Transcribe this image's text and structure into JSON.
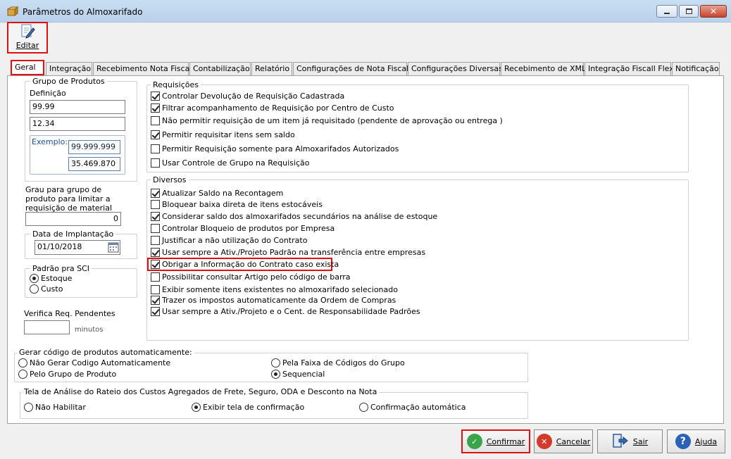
{
  "window": {
    "title": "Parâmetros do Almoxarifado",
    "controls": [
      "minimize-icon",
      "maximize-icon",
      "close-icon"
    ]
  },
  "toolbar": {
    "edit_label": "Editar"
  },
  "tabs": [
    {
      "label": "Geral",
      "active": true
    },
    {
      "label": "Integração"
    },
    {
      "label": "Recebimento Nota Fiscal"
    },
    {
      "label": "Contabilização"
    },
    {
      "label": "Relatório"
    },
    {
      "label": "Configurações de Nota Fiscal"
    },
    {
      "label": "Configurações Diversas"
    },
    {
      "label": "Recebimento de XML"
    },
    {
      "label": "Integração Fiscall Flex"
    },
    {
      "label": "Notificação"
    }
  ],
  "grupo_produtos": {
    "title": "Grupo de Produtos",
    "definicao_label": "Definição",
    "definicao_value": "99.99",
    "second_value": "12.34",
    "exemplo_label": "Exemplo:",
    "exemplo_1": "99.999.999",
    "exemplo_2": "35.469.870"
  },
  "grau": {
    "label": "Grau para grupo de produto para limitar a requisição de material",
    "value": "0"
  },
  "data_implantacao": {
    "title": "Data de Implantação",
    "value": "01/10/2018"
  },
  "padrao_sci": {
    "title": "Padrão pra SCI",
    "options": [
      {
        "label": "Estoque",
        "selected": true
      },
      {
        "label": "Custo",
        "selected": false
      }
    ]
  },
  "verifica": {
    "label": "Verifica Req. Pendentes",
    "value": "",
    "unit": "minutos"
  },
  "requisicoes": {
    "title": "Requisições",
    "items": [
      {
        "label": "Controlar Devolução de Requisição Cadastrada",
        "checked": true
      },
      {
        "label": "Filtrar acompanhamento de Requisição por Centro de Custo",
        "checked": true
      },
      {
        "label": "Não permitir requisição de um item já requisitado (pendente de aprovação ou entrega )",
        "checked": false
      },
      {
        "label": "Permitir requisitar itens sem saldo",
        "checked": true
      },
      {
        "label": "Permitir Requisição somente para Almoxarifados Autorizados",
        "checked": false
      },
      {
        "label": "Usar Controle de Grupo na Requisição",
        "checked": false
      }
    ]
  },
  "diversos": {
    "title": "Diversos",
    "items": [
      {
        "label": "Atualizar Saldo na Recontagem",
        "checked": true
      },
      {
        "label": "Bloquear baixa direta de itens estocáveis",
        "checked": false
      },
      {
        "label": "Considerar saldo dos almoxarifados secundários na análise de estoque",
        "checked": true
      },
      {
        "label": "Controlar Bloqueio de produtos por Empresa",
        "checked": false
      },
      {
        "label": "Justificar a não utilização do Contrato",
        "checked": false
      },
      {
        "label": "Usar sempre a Ativ./Projeto Padrão na transferência entre empresas",
        "checked": true
      },
      {
        "label": "Obrigar a Informação do Contrato caso exista",
        "checked": true
      },
      {
        "label": "Possibilitar consultar Artigo pelo código de barra",
        "checked": false
      },
      {
        "label": "Exibir somente itens existentes no almoxarifado selecionado",
        "checked": false
      },
      {
        "label": "Trazer os impostos automaticamente da Ordem de Compras",
        "checked": true
      },
      {
        "label": "Usar sempre a Ativ./Projeto e o Cent. de Responsabilidade Padrões",
        "checked": true
      }
    ]
  },
  "gerar_codigo": {
    "title": "Gerar código de produtos automaticamente:",
    "options": [
      {
        "label": "Não Gerar Codigo Automaticamente",
        "selected": false
      },
      {
        "label": "Pela Faixa de Códigos do Grupo",
        "selected": false
      },
      {
        "label": "Pelo Grupo de Produto",
        "selected": false
      },
      {
        "label": "Sequencial",
        "selected": true
      }
    ]
  },
  "rateio": {
    "title": "Tela de Análise do Rateio dos Custos Agregados de Frete, Seguro, ODA e Desconto na Nota",
    "options": [
      {
        "label": "Não Habilitar",
        "selected": false
      },
      {
        "label": "Exibir tela de confirmação",
        "selected": true
      },
      {
        "label": "Confirmação automática",
        "selected": false
      }
    ]
  },
  "buttons": {
    "confirmar": "Confirmar",
    "cancelar": "Cancelar",
    "sair": "Sair",
    "ajuda": "Ajuda"
  }
}
